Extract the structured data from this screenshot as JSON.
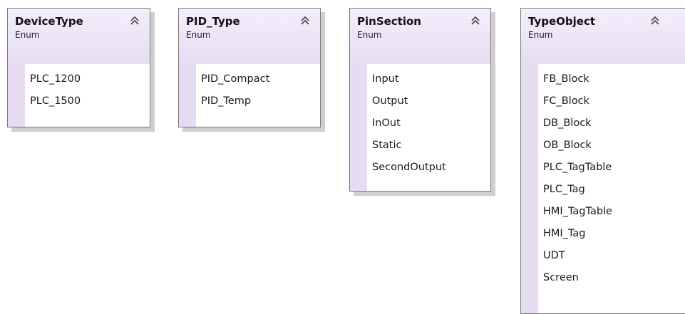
{
  "diagram": {
    "enums": [
      {
        "name": "DeviceType",
        "kind": "Enum",
        "members": [
          "PLC_1200",
          "PLC_1500"
        ]
      },
      {
        "name": "PID_Type",
        "kind": "Enum",
        "members": [
          "PID_Compact",
          "PID_Temp"
        ]
      },
      {
        "name": "PinSection",
        "kind": "Enum",
        "members": [
          "Input",
          "Output",
          "InOut",
          "Static",
          "SecondOutput"
        ]
      },
      {
        "name": "TypeObject",
        "kind": "Enum",
        "members": [
          "FB_Block",
          "FC_Block",
          "DB_Block",
          "OB_Block",
          "PLC_TagTable",
          "PLC_Tag",
          "HMI_TagTable",
          "HMI_Tag",
          "UDT",
          "Screen"
        ]
      }
    ]
  },
  "icons": {
    "collapse": "double-chevron-up-icon"
  },
  "colors": {
    "header_fill": "#e6ddf2",
    "border": "#7a7a7a",
    "shadow": "#cfcfcf",
    "body": "#ffffff"
  }
}
